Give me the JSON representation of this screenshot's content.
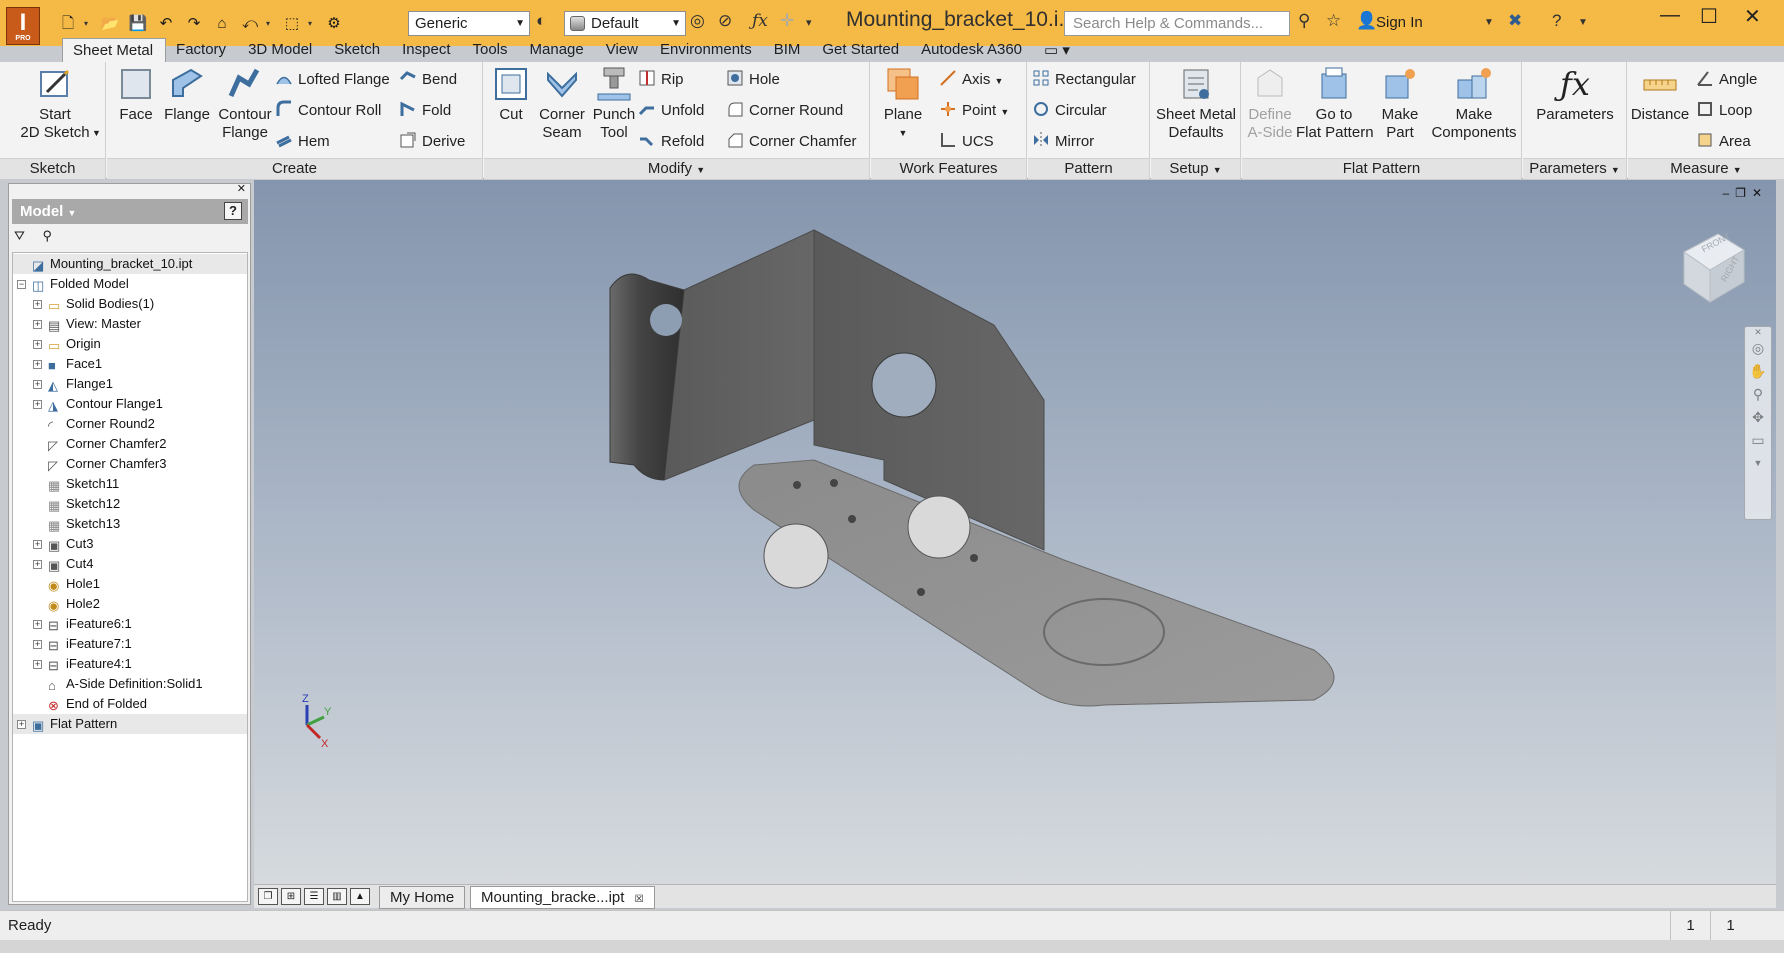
{
  "app": {
    "logo_letter": "I",
    "logo_edition": "PRO",
    "document_title": "Mounting_bracket_10.i...",
    "search_placeholder": "Search Help & Commands...",
    "sign_in": "Sign In"
  },
  "qat": {
    "material": "Generic",
    "appearance": "Default"
  },
  "tabs": [
    "Sheet Metal",
    "Factory",
    "3D Model",
    "Sketch",
    "Inspect",
    "Tools",
    "Manage",
    "View",
    "Environments",
    "BIM",
    "Get Started",
    "Autodesk A360"
  ],
  "ribbon": {
    "sketch": {
      "title": "Sketch",
      "start_sketch": "Start\n2D Sketch"
    },
    "create": {
      "title": "Create",
      "face": "Face",
      "flange": "Flange",
      "contour_flange": "Contour\nFlange",
      "lofted_flange": "Lofted Flange",
      "contour_roll": "Contour Roll",
      "hem": "Hem",
      "bend": "Bend",
      "fold": "Fold",
      "derive": "Derive"
    },
    "modify": {
      "title": "Modify",
      "cut": "Cut",
      "corner_seam": "Corner\nSeam",
      "punch_tool": "Punch\nTool",
      "rip": "Rip",
      "unfold": "Unfold",
      "refold": "Refold",
      "hole": "Hole",
      "corner_round": "Corner Round",
      "corner_chamfer": "Corner Chamfer"
    },
    "work_features": {
      "title": "Work Features",
      "plane": "Plane",
      "axis": "Axis",
      "point": "Point",
      "ucs": "UCS"
    },
    "pattern": {
      "title": "Pattern",
      "rectangular": "Rectangular",
      "circular": "Circular",
      "mirror": "Mirror"
    },
    "setup": {
      "title": "Setup",
      "sheet_metal_defaults": "Sheet Metal\nDefaults"
    },
    "flat_pattern": {
      "title": "Flat Pattern",
      "define_a_side": "Define\nA-Side",
      "go_to_flat_pattern": "Go to\nFlat Pattern",
      "make_part": "Make\nPart",
      "make_components": "Make\nComponents"
    },
    "parameters": {
      "title": "Parameters",
      "parameters": "Parameters"
    },
    "measure": {
      "title": "Measure",
      "distance": "Distance",
      "angle": "Angle",
      "loop": "Loop",
      "area": "Area"
    }
  },
  "browser": {
    "title": "Model",
    "help": "?",
    "tree": [
      {
        "label": "Mounting_bracket_10.ipt",
        "level": 0,
        "expander": "",
        "icon": "part-icon"
      },
      {
        "label": "Folded Model",
        "level": 0,
        "expander": "−",
        "icon": "folded-model-icon"
      },
      {
        "label": "Solid Bodies(1)",
        "level": 1,
        "expander": "+",
        "icon": "folder-icon"
      },
      {
        "label": "View: Master",
        "level": 1,
        "expander": "+",
        "icon": "view-icon"
      },
      {
        "label": "Origin",
        "level": 1,
        "expander": "+",
        "icon": "folder-icon"
      },
      {
        "label": "Face1",
        "level": 1,
        "expander": "+",
        "icon": "face-icon"
      },
      {
        "label": "Flange1",
        "level": 1,
        "expander": "+",
        "icon": "flange-icon"
      },
      {
        "label": "Contour Flange1",
        "level": 1,
        "expander": "+",
        "icon": "contour-flange-icon"
      },
      {
        "label": "Corner Round2",
        "level": 1,
        "expander": "",
        "icon": "corner-round-icon"
      },
      {
        "label": "Corner Chamfer2",
        "level": 1,
        "expander": "",
        "icon": "corner-chamfer-icon"
      },
      {
        "label": "Corner Chamfer3",
        "level": 1,
        "expander": "",
        "icon": "corner-chamfer-icon"
      },
      {
        "label": "Sketch11",
        "level": 1,
        "expander": "",
        "icon": "sketch-icon"
      },
      {
        "label": "Sketch12",
        "level": 1,
        "expander": "",
        "icon": "sketch-icon"
      },
      {
        "label": "Sketch13",
        "level": 1,
        "expander": "",
        "icon": "sketch-icon"
      },
      {
        "label": "Cut3",
        "level": 1,
        "expander": "+",
        "icon": "cut-icon"
      },
      {
        "label": "Cut4",
        "level": 1,
        "expander": "+",
        "icon": "cut-icon"
      },
      {
        "label": "Hole1",
        "level": 1,
        "expander": "",
        "icon": "hole-icon"
      },
      {
        "label": "Hole2",
        "level": 1,
        "expander": "",
        "icon": "hole-icon"
      },
      {
        "label": "iFeature6:1",
        "level": 1,
        "expander": "+",
        "icon": "ifeature-icon"
      },
      {
        "label": "iFeature7:1",
        "level": 1,
        "expander": "+",
        "icon": "ifeature-icon"
      },
      {
        "label": "iFeature4:1",
        "level": 1,
        "expander": "+",
        "icon": "ifeature-icon"
      },
      {
        "label": "A-Side Definition:Solid1",
        "level": 1,
        "expander": "",
        "icon": "a-side-icon"
      },
      {
        "label": "End of Folded",
        "level": 1,
        "expander": "",
        "icon": "end-of-part-icon"
      },
      {
        "label": "Flat Pattern",
        "level": 0,
        "expander": "+",
        "icon": "flat-pattern-icon"
      }
    ]
  },
  "doc_tabs": {
    "home": "My Home",
    "active": "Mounting_bracke...ipt"
  },
  "viewcube": {
    "front": "FRONT",
    "right": "RIGHT"
  },
  "status": {
    "text": "Ready",
    "count1": "1",
    "count2": "1"
  },
  "colors": {
    "titlebar": "#f5b945",
    "ribbon": "#f3f3f3",
    "viewport_top": "#8495ad",
    "viewport_bottom": "#d6dade",
    "part": "#6f6f6f"
  }
}
